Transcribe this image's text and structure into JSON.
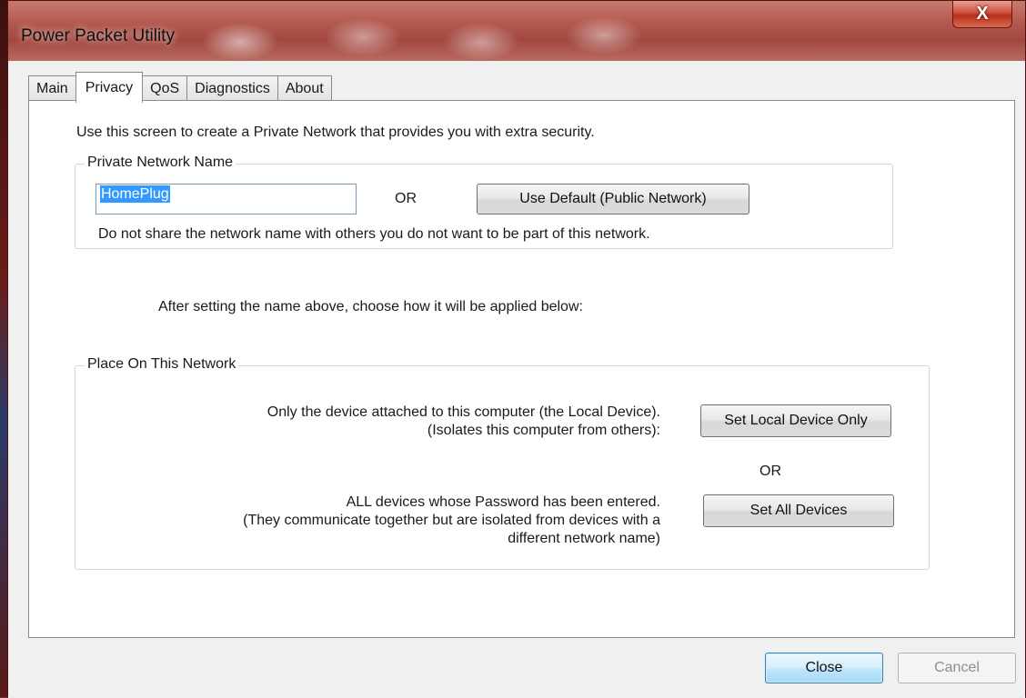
{
  "window": {
    "title": "Power Packet Utility",
    "close_glyph": "X"
  },
  "tabs": [
    {
      "label": "Main"
    },
    {
      "label": "Privacy"
    },
    {
      "label": "QoS"
    },
    {
      "label": "Diagnostics"
    },
    {
      "label": "About"
    }
  ],
  "active_tab": "Privacy",
  "privacy": {
    "intro": "Use this screen to create a Private Network that provides you with extra security.",
    "name_group": {
      "label": "Private Network Name",
      "name_value": "HomePlug",
      "or_label": "OR",
      "default_button": "Use Default (Public Network)",
      "warning": "Do not share the network name with others you do not want to be part of this network."
    },
    "after_text": "After setting the name above, choose how it will be applied below:",
    "place_group": {
      "label": "Place On This Network",
      "local_line1": "Only the device attached to this computer (the Local Device).",
      "local_line2": "(Isolates this computer from others):",
      "local_button": "Set Local Device Only",
      "or_label": "OR",
      "all_line1": "ALL devices whose Password has been entered.",
      "all_line2": "(They communicate together but are isolated from devices with a",
      "all_line3": "different network name)",
      "all_button": "Set All Devices"
    }
  },
  "footer": {
    "close_button": "Close",
    "cancel_button": "Cancel"
  },
  "colors": {
    "selection": "#3399ff",
    "titlebar": "#b45a50",
    "close_button_accent": "#3c7fb1"
  }
}
